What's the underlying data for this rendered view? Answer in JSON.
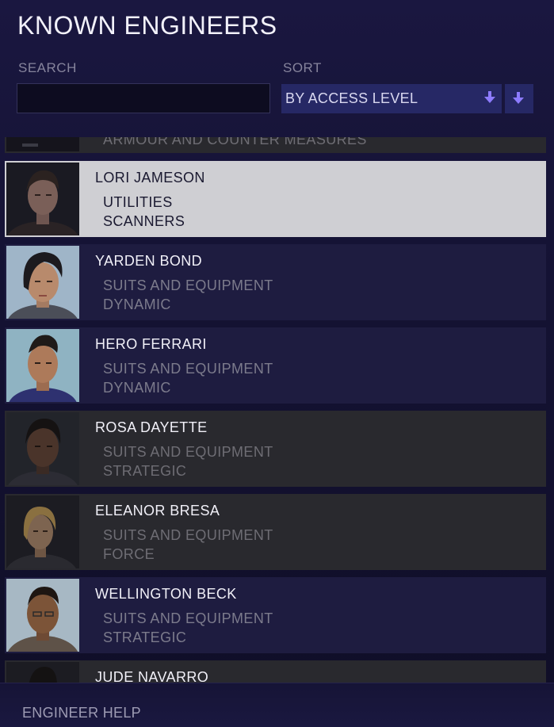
{
  "panel": {
    "title": "KNOWN ENGINEERS"
  },
  "search": {
    "label": "SEARCH",
    "value": "",
    "placeholder": ""
  },
  "sort": {
    "label": "SORT",
    "selected": "BY ACCESS LEVEL"
  },
  "colors": {
    "accent": "#8d7bff",
    "row_default": "#1e1c40",
    "row_selected": "#cfcfd3",
    "row_grey": "#29292e"
  },
  "engineers": [
    {
      "name": "",
      "specialty": "ARMOUR AND COUNTER MEASURES",
      "subtype": ""
    },
    {
      "name": "LORI JAMESON",
      "specialty": "UTILITIES",
      "subtype": "SCANNERS"
    },
    {
      "name": "YARDEN BOND",
      "specialty": "SUITS AND EQUIPMENT",
      "subtype": "DYNAMIC"
    },
    {
      "name": "HERO FERRARI",
      "specialty": "SUITS AND EQUIPMENT",
      "subtype": "DYNAMIC"
    },
    {
      "name": "ROSA DAYETTE",
      "specialty": "SUITS AND EQUIPMENT",
      "subtype": "STRATEGIC"
    },
    {
      "name": "ELEANOR BRESA",
      "specialty": "SUITS AND EQUIPMENT",
      "subtype": "FORCE"
    },
    {
      "name": "WELLINGTON BECK",
      "specialty": "SUITS AND EQUIPMENT",
      "subtype": "STRATEGIC"
    },
    {
      "name": "JUDE NAVARRO",
      "specialty": "",
      "subtype": ""
    }
  ],
  "footer": {
    "help_label": "ENGINEER HELP"
  },
  "icons": {
    "sort_select": "arrow-down-icon",
    "sort_direction": "arrow-down-icon"
  }
}
